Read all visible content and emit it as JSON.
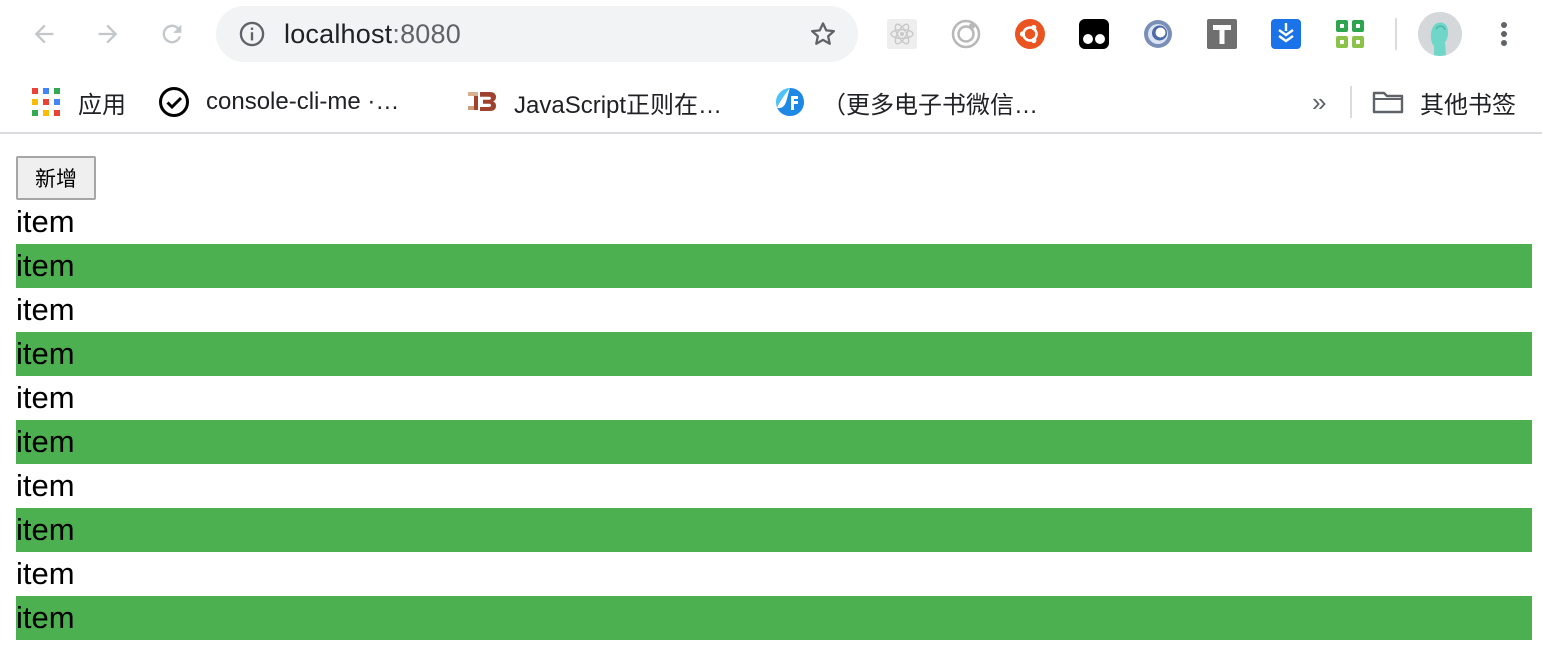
{
  "browser": {
    "url_host": "localhost",
    "url_port": ":8080",
    "extensions": [
      "react-devtools-icon",
      "target-icon",
      "ubuntu-icon",
      "tampermonkey-icon",
      "ring-icon",
      "t-letter-icon",
      "download-icon",
      "grid-app-icon"
    ]
  },
  "bookmarks": {
    "apps_label": "应用",
    "items": [
      {
        "label": "console-cli-me ·…",
        "icon": "check-circle-icon"
      },
      {
        "label": "JavaScript正则在…",
        "icon": "jb-logo-icon"
      },
      {
        "label": "（更多电子书微信…",
        "icon": "f-logo-icon"
      }
    ],
    "overflow": "»",
    "other_label": "其他书签"
  },
  "page": {
    "add_button_label": "新增",
    "items": [
      "item",
      "item",
      "item",
      "item",
      "item",
      "item",
      "item",
      "item",
      "item",
      "item"
    ],
    "highlight_color": "#4caf50"
  }
}
